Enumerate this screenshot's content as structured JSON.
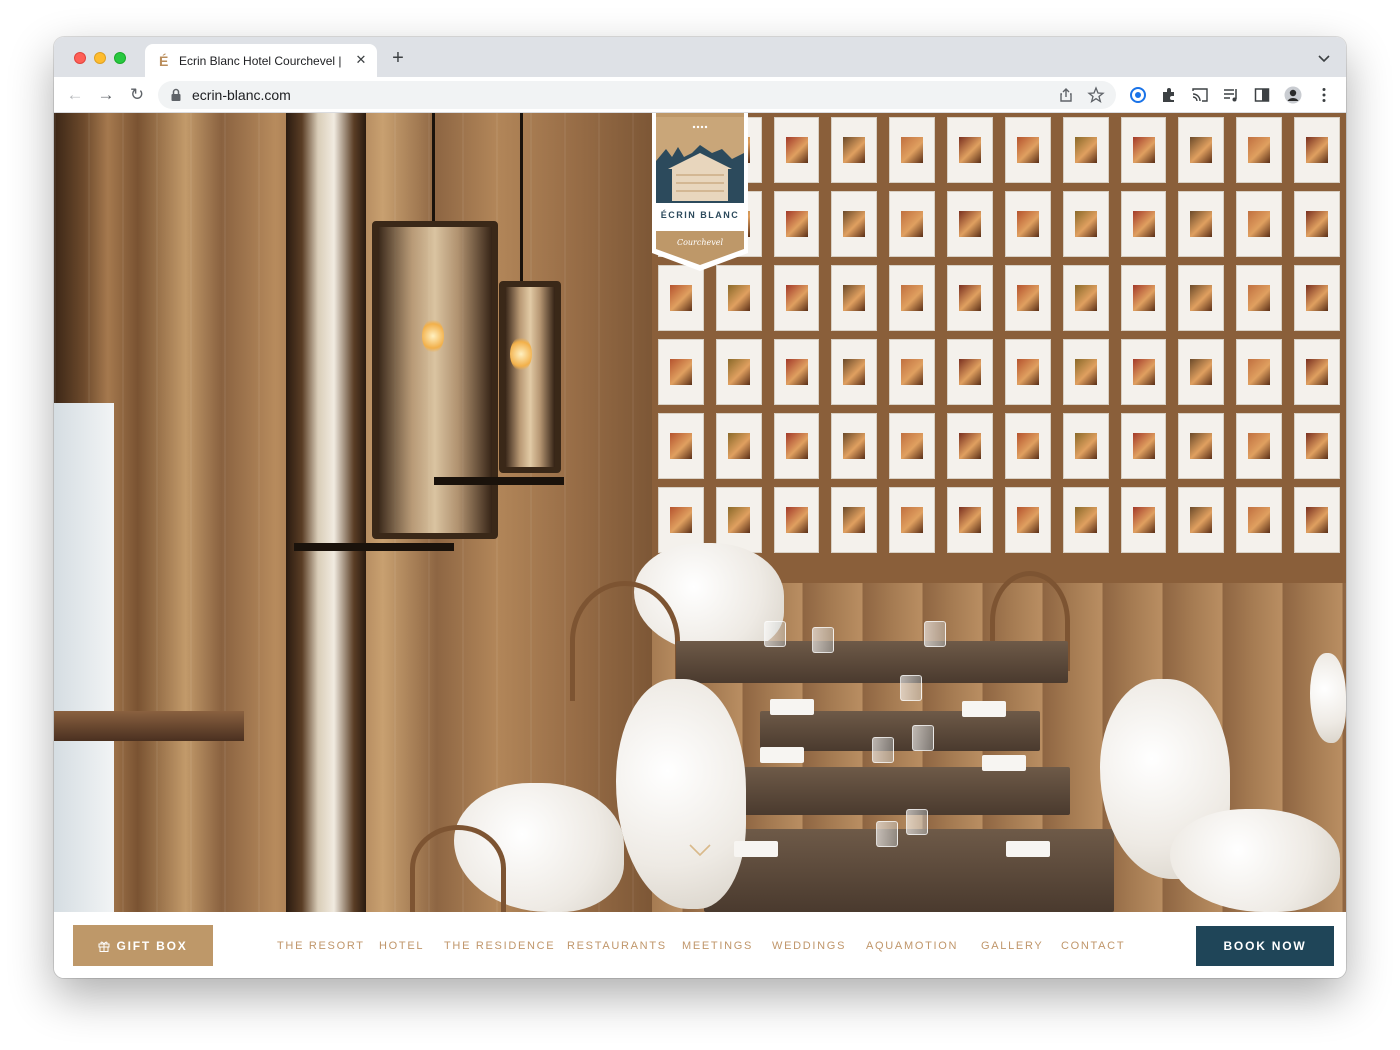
{
  "browser": {
    "tab_title": "Ecrin Blanc Hotel Courchevel |",
    "url": "ecrin-blanc.com"
  },
  "logo": {
    "brand": "ÉCRIN BLANC",
    "subtitle": "Courchevel"
  },
  "nav": {
    "gift_label": "GIFT BOX",
    "links": [
      "THE RESORT",
      "HOTEL",
      "THE RESIDENCE",
      "RESTAURANTS",
      "MEETINGS",
      "WEDDINGS",
      "AQUAMOTION",
      "GALLERY",
      "CONTACT"
    ],
    "book_label": "BOOK NOW"
  },
  "colors": {
    "accent_gold": "#be9869",
    "nav_text": "#c0966a",
    "book_button": "#1f4558",
    "logo_navy": "#2c4a5c"
  },
  "icons": [
    "lock-icon",
    "share-icon",
    "star-icon",
    "extension-icon",
    "puzzle-icon",
    "cast-icon",
    "media-icon",
    "sidepanel-icon",
    "profile-avatar",
    "kebab-menu-icon",
    "gift-icon",
    "chevron-down-icon"
  ]
}
